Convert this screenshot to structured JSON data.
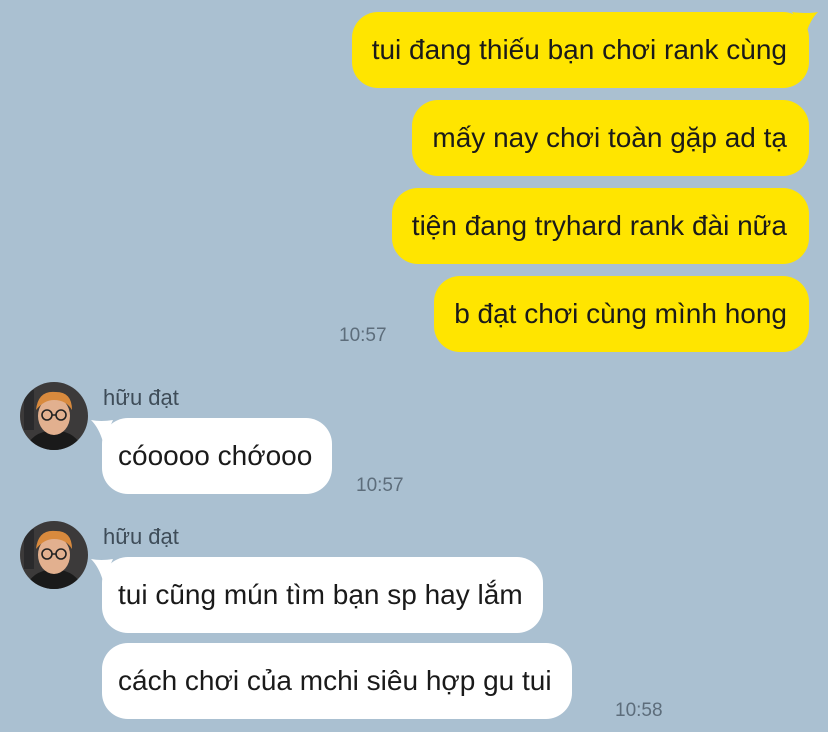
{
  "colors": {
    "background": "#aac0d1",
    "outgoing_bubble": "#ffe500",
    "incoming_bubble": "#ffffff"
  },
  "outgoing": [
    {
      "text": "tui đang thiếu bạn chơi rank cùng"
    },
    {
      "text": "mấy nay chơi toàn gặp ad tạ"
    },
    {
      "text": "tiện đang tryhard rank đài nữa"
    },
    {
      "text": "b đạt chơi cùng mình hong"
    }
  ],
  "outgoing_time": "10:57",
  "incoming_groups": [
    {
      "sender": "hữu đạt",
      "avatar_icon": "user-avatar-icon",
      "messages": [
        {
          "text": "cóoooo chớooo"
        }
      ],
      "time": "10:57"
    },
    {
      "sender": "hữu đạt",
      "avatar_icon": "user-avatar-icon",
      "messages": [
        {
          "text": "tui cũng mún tìm bạn sp hay lắm"
        },
        {
          "text": "cách chơi của mchi siêu hợp gu tui"
        }
      ],
      "time": "10:58"
    }
  ]
}
